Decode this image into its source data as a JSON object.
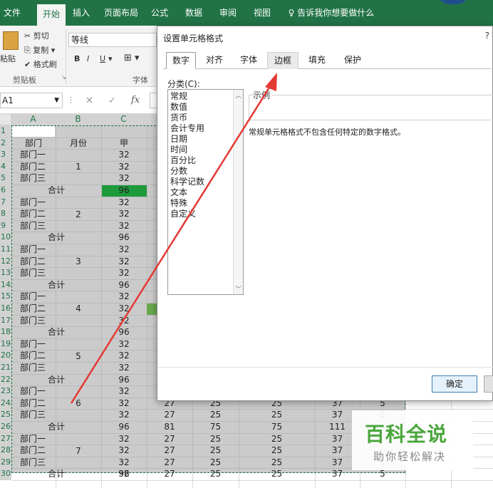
{
  "ribbon": {
    "tabs": [
      "文件",
      "开始",
      "插入",
      "页面布局",
      "公式",
      "数据",
      "审阅",
      "视图"
    ],
    "active_tab": "开始",
    "tell_me": "告诉我你想要做什么",
    "paste_label": "粘贴",
    "cut_label": "剪切",
    "copy_label": "复制",
    "format_painter_label": "格式刷",
    "clipboard_group": "剪贴板",
    "font_name": "等线",
    "bold": "B",
    "italic": "I",
    "underline": "U",
    "font_group": "字体"
  },
  "formula_bar": {
    "name_box": "A1",
    "cancel": "✕",
    "enter": "✓",
    "fx": "fx"
  },
  "sheet": {
    "columns": [
      "A",
      "B",
      "C"
    ],
    "rows": [
      "1",
      "2",
      "3",
      "4",
      "5",
      "6",
      "7",
      "8",
      "9",
      "10",
      "11",
      "12",
      "13",
      "14",
      "15",
      "16",
      "17",
      "18",
      "19",
      "20",
      "21",
      "22",
      "23",
      "24",
      "25",
      "26",
      "27",
      "28",
      "29",
      "30"
    ],
    "header_row": {
      "a": "部门",
      "b": "月份",
      "c": "甲"
    },
    "dept_labels": [
      "部门一",
      "部门二",
      "部门三"
    ],
    "total_label": "合计",
    "months": [
      "1",
      "2",
      "3",
      "4",
      "5",
      "6",
      "7"
    ],
    "dept_value": "32",
    "total_value": "96",
    "right_rows": [
      {
        "d": "27",
        "e": "25",
        "f": "25",
        "g": "37",
        "h": "5"
      },
      {
        "d": "27",
        "e": "25",
        "f": "25",
        "g": "37",
        "h": "5"
      },
      {
        "d": "81",
        "e": "75",
        "f": "75",
        "g": "111",
        "h": ""
      },
      {
        "d": "27",
        "e": "25",
        "f": "25",
        "g": "37",
        "h": ""
      },
      {
        "d": "27",
        "e": "25",
        "f": "25",
        "g": "37",
        "h": ""
      },
      {
        "d": "27",
        "e": "25",
        "f": "25",
        "g": "37",
        "h": "5"
      },
      {
        "d": "27",
        "e": "25",
        "f": "25",
        "g": "37",
        "h": "5"
      }
    ]
  },
  "dialog": {
    "title": "设置单元格格式",
    "help": "?",
    "tabs": [
      "数字",
      "对齐",
      "字体",
      "边框",
      "填充",
      "保护"
    ],
    "active_tab": "数字",
    "category_label": "分类(C):",
    "categories": [
      "常规",
      "数值",
      "货币",
      "会计专用",
      "日期",
      "时间",
      "百分比",
      "分数",
      "科学记数",
      "文本",
      "特殊",
      "自定义"
    ],
    "sample_label": "示例",
    "description": "常规单元格格式不包含任何特定的数字格式。",
    "ok_label": "确定"
  },
  "watermark": {
    "main": "百科全说",
    "sub": "助你轻松解决"
  },
  "colors": {
    "ribbon_green": "#217346",
    "highlight_green": "#1e9a3c",
    "arrow_red": "#e53935"
  }
}
